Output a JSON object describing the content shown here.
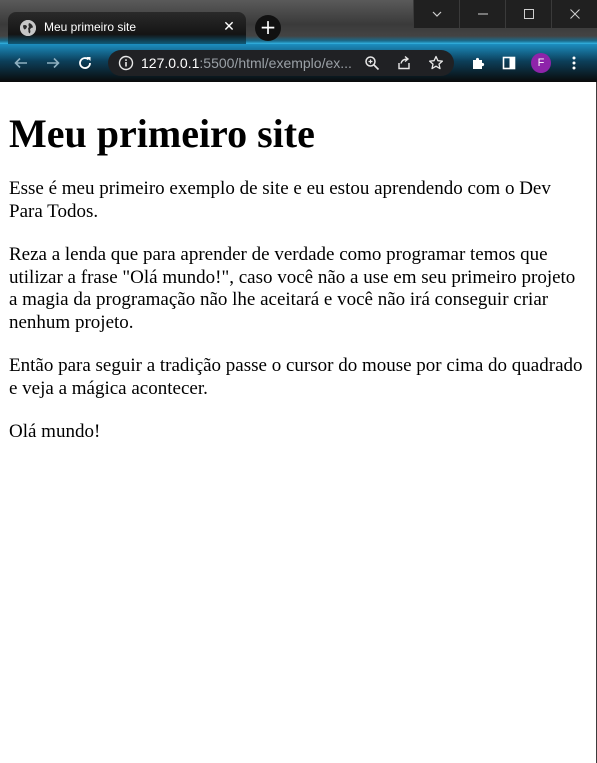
{
  "browser": {
    "tab": {
      "title": "Meu primeiro site",
      "favicon": "globe-icon",
      "close_label": "✕"
    },
    "new_tab_label": "+",
    "window_controls": [
      "chevron-down-icon",
      "minimize-icon",
      "maximize-icon",
      "close-icon"
    ],
    "address": {
      "host": "127.0.0.1",
      "rest": ":5500/html/exemplo/ex..."
    },
    "profile_initial": "F",
    "profile_color": "#8e24aa"
  },
  "page": {
    "heading": "Meu primeiro site",
    "paragraphs": [
      "Esse é meu primeiro exemplo de site e eu estou aprendendo com o Dev Para Todos.",
      "Reza a lenda que para aprender de verdade como programar temos que utilizar a frase \"Olá mundo!\", caso você não a use em seu primeiro projeto a magia da programação não lhe aceitará e você não irá conseguir criar nenhum projeto.",
      "Então para seguir a tradição passe o cursor do mouse por cima do quadrado e veja a mágica acontecer.",
      "Olá mundo!"
    ]
  }
}
